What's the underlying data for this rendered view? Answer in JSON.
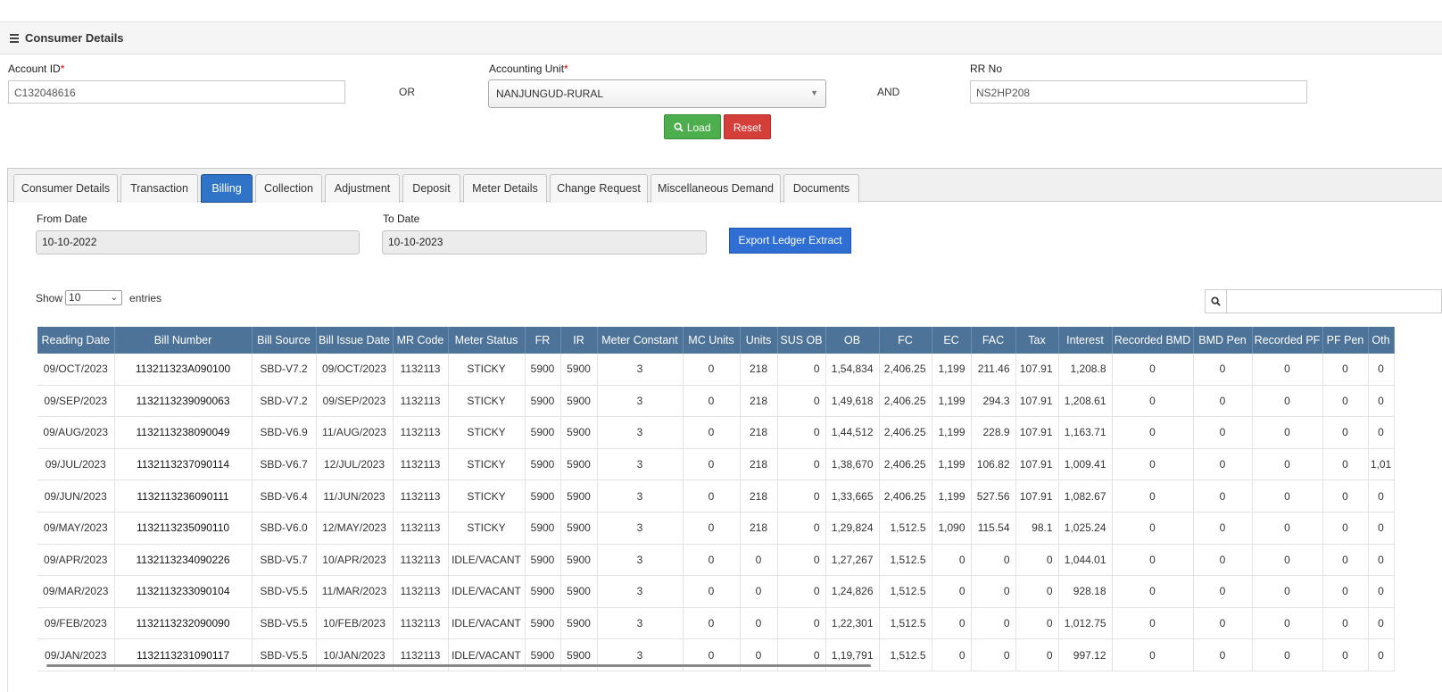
{
  "panel": {
    "title": "Consumer Details"
  },
  "form": {
    "account_id_label": "Account ID",
    "account_id_value": "C132048616",
    "or_text": "OR",
    "accounting_unit_label": "Accounting Unit",
    "accounting_unit_value": "NANJUNGUD-RURAL",
    "and_text": "AND",
    "rr_no_label": "RR No",
    "rr_no_value": "NS2HP208",
    "required_marker": "*",
    "load_label": "Load",
    "reset_label": "Reset"
  },
  "tabs": [
    {
      "label": "Consumer Details"
    },
    {
      "label": "Transaction"
    },
    {
      "label": "Billing",
      "active": true
    },
    {
      "label": "Collection"
    },
    {
      "label": "Adjustment"
    },
    {
      "label": "Deposit"
    },
    {
      "label": "Meter Details"
    },
    {
      "label": "Change Request"
    },
    {
      "label": "Miscellaneous Demand"
    },
    {
      "label": "Documents"
    }
  ],
  "billing": {
    "from_date_label": "From Date",
    "from_date_value": "10-10-2022",
    "to_date_label": "To Date",
    "to_date_value": "10-10-2023",
    "export_label": "Export Ledger Extract",
    "show_label": "Show",
    "show_value": "10",
    "entries_label": "entries"
  },
  "table": {
    "columns": [
      "Reading Date",
      "Bill Number",
      "Bill Source",
      "Bill Issue Date",
      "MR Code",
      "Meter Status",
      "FR",
      "IR",
      "Meter Constant",
      "MC Units",
      "Units",
      "SUS OB",
      "OB",
      "FC",
      "EC",
      "FAC",
      "Tax",
      "Interest",
      "Recorded BMD",
      "BMD Pen",
      "Recorded PF",
      "PF Pen",
      "Oth"
    ],
    "rows": [
      [
        "09/OCT/2023",
        "113211323A090100",
        "SBD-V7.2",
        "09/OCT/2023",
        "1132113",
        "STICKY",
        "5900",
        "5900",
        "3",
        "0",
        "218",
        "0",
        "1,54,834",
        "2,406.25",
        "1,199",
        "211.46",
        "107.91",
        "1,208.8",
        "0",
        "0",
        "0",
        "0",
        "0"
      ],
      [
        "09/SEP/2023",
        "1132113239090063",
        "SBD-V7.2",
        "09/SEP/2023",
        "1132113",
        "STICKY",
        "5900",
        "5900",
        "3",
        "0",
        "218",
        "0",
        "1,49,618",
        "2,406.25",
        "1,199",
        "294.3",
        "107.91",
        "1,208.61",
        "0",
        "0",
        "0",
        "0",
        "0"
      ],
      [
        "09/AUG/2023",
        "1132113238090049",
        "SBD-V6.9",
        "11/AUG/2023",
        "1132113",
        "STICKY",
        "5900",
        "5900",
        "3",
        "0",
        "218",
        "0",
        "1,44,512",
        "2,406.25",
        "1,199",
        "228.9",
        "107.91",
        "1,163.71",
        "0",
        "0",
        "0",
        "0",
        "0"
      ],
      [
        "09/JUL/2023",
        "1132113237090114",
        "SBD-V6.7",
        "12/JUL/2023",
        "1132113",
        "STICKY",
        "5900",
        "5900",
        "3",
        "0",
        "218",
        "0",
        "1,38,670",
        "2,406.25",
        "1,199",
        "106.82",
        "107.91",
        "1,009.41",
        "0",
        "0",
        "0",
        "0",
        "1,01"
      ],
      [
        "09/JUN/2023",
        "1132113236090111",
        "SBD-V6.4",
        "11/JUN/2023",
        "1132113",
        "STICKY",
        "5900",
        "5900",
        "3",
        "0",
        "218",
        "0",
        "1,33,665",
        "2,406.25",
        "1,199",
        "527.56",
        "107.91",
        "1,082.67",
        "0",
        "0",
        "0",
        "0",
        "0"
      ],
      [
        "09/MAY/2023",
        "1132113235090110",
        "SBD-V6.0",
        "12/MAY/2023",
        "1132113",
        "STICKY",
        "5900",
        "5900",
        "3",
        "0",
        "218",
        "0",
        "1,29,824",
        "1,512.5",
        "1,090",
        "115.54",
        "98.1",
        "1,025.24",
        "0",
        "0",
        "0",
        "0",
        "0"
      ],
      [
        "09/APR/2023",
        "1132113234090226",
        "SBD-V5.7",
        "10/APR/2023",
        "1132113",
        "IDLE/VACANT",
        "5900",
        "5900",
        "3",
        "0",
        "0",
        "0",
        "1,27,267",
        "1,512.5",
        "0",
        "0",
        "0",
        "1,044.01",
        "0",
        "0",
        "0",
        "0",
        "0"
      ],
      [
        "09/MAR/2023",
        "1132113233090104",
        "SBD-V5.5",
        "11/MAR/2023",
        "1132113",
        "IDLE/VACANT",
        "5900",
        "5900",
        "3",
        "0",
        "0",
        "0",
        "1,24,826",
        "1,512.5",
        "0",
        "0",
        "0",
        "928.18",
        "0",
        "0",
        "0",
        "0",
        "0"
      ],
      [
        "09/FEB/2023",
        "1132113232090090",
        "SBD-V5.5",
        "10/FEB/2023",
        "1132113",
        "IDLE/VACANT",
        "5900",
        "5900",
        "3",
        "0",
        "0",
        "0",
        "1,22,301",
        "1,512.5",
        "0",
        "0",
        "0",
        "1,012.75",
        "0",
        "0",
        "0",
        "0",
        "0"
      ],
      [
        "09/JAN/2023",
        "1132113231090117",
        "SBD-V5.5",
        "10/JAN/2023",
        "1132113",
        "IDLE/VACANT",
        "5900",
        "5900",
        "3",
        "0",
        "0",
        "0",
        "1,19,791",
        "1,512.5",
        "0",
        "0",
        "0",
        "997.12",
        "0",
        "0",
        "0",
        "0",
        "0"
      ]
    ]
  },
  "icons": {
    "menu": "hamburger-icon",
    "load": "search-icon",
    "search": "search-icon",
    "dropdown": "caret-down-icon"
  },
  "colors": {
    "header_bg": "#4d7398",
    "active_tab": "#2f74c7",
    "load_btn": "#4cae4c",
    "reset_btn": "#d43f3a",
    "export_btn": "#2f6fd4"
  }
}
